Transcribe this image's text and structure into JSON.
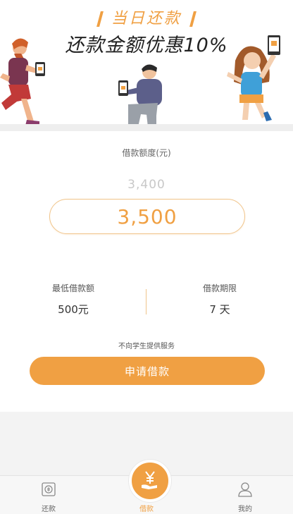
{
  "banner": {
    "subtitle": "当日还款",
    "title": "还款金额优惠10%"
  },
  "loan": {
    "amount_label": "借款额度(元)",
    "previous_amount": "3,400",
    "current_amount": "3,500",
    "min_label": "最低借款额",
    "min_value": "500元",
    "term_label": "借款期限",
    "term_value": "7 天",
    "notice": "不向学生提供服务",
    "apply_label": "申请借款"
  },
  "tabs": [
    {
      "label": "还款",
      "icon": "repay-coin-icon"
    },
    {
      "label": "借款",
      "icon": "yen-hand-icon"
    },
    {
      "label": "我的",
      "icon": "user-profile-icon"
    }
  ],
  "colors": {
    "accent": "#f0a043",
    "background": "#f3f3f3"
  }
}
